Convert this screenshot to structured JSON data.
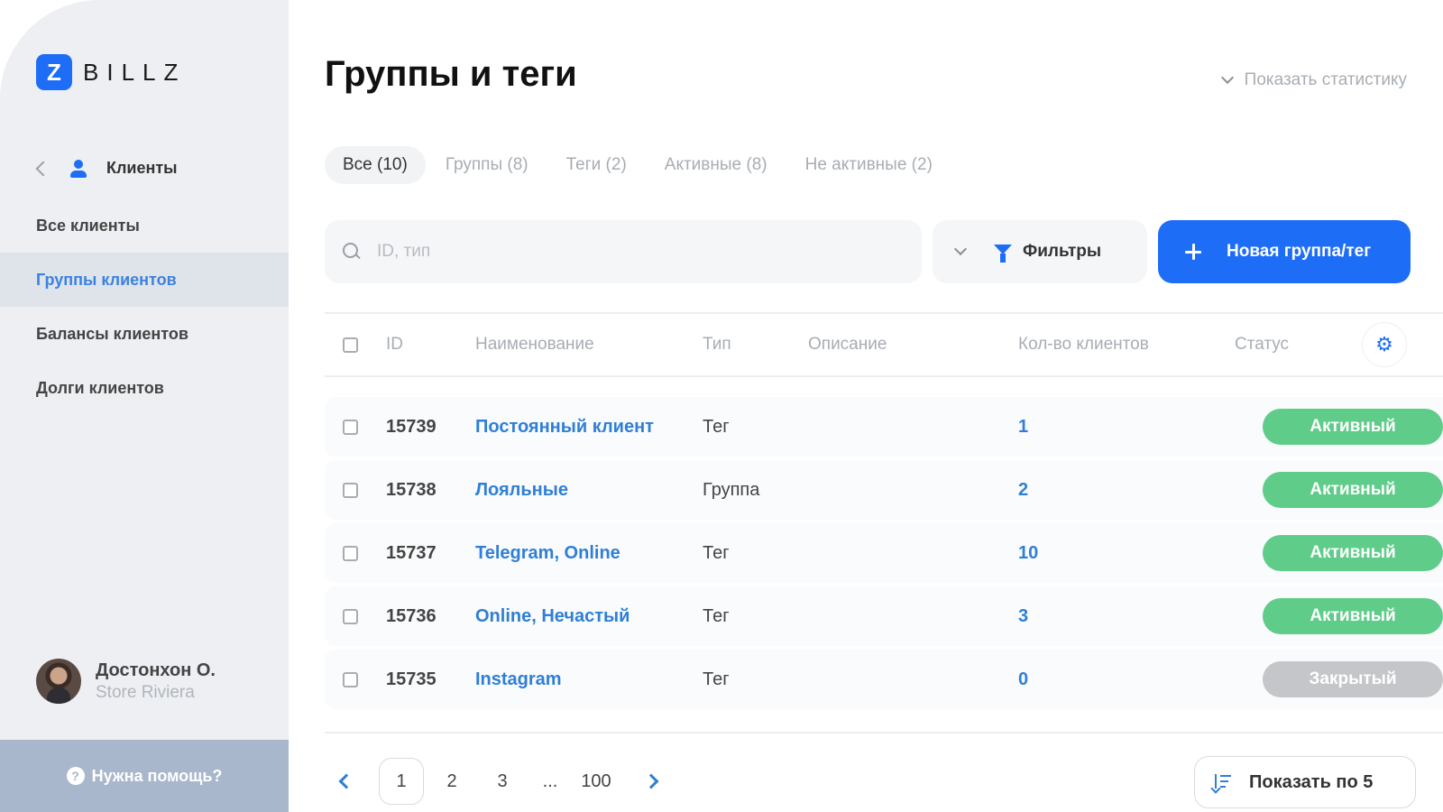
{
  "brand": {
    "mark": "Z",
    "name": "BILLZ",
    "color": "#1e6df6"
  },
  "sidebar": {
    "section": "Клиенты",
    "items": [
      {
        "label": "Все клиенты",
        "active": false
      },
      {
        "label": "Группы клиентов",
        "active": true
      },
      {
        "label": "Балансы клиентов",
        "active": false
      },
      {
        "label": "Долги клиентов",
        "active": false
      }
    ],
    "profile": {
      "name": "Достонхон О.",
      "store": "Store Riviera"
    },
    "help": "Нужна помощь?"
  },
  "header": {
    "title": "Группы и теги",
    "stats_toggle": "Показать статистику"
  },
  "tabs": [
    {
      "label": "Все (10)",
      "active": true
    },
    {
      "label": "Группы (8)",
      "active": false
    },
    {
      "label": "Теги (2)",
      "active": false
    },
    {
      "label": "Активные (8)",
      "active": false
    },
    {
      "label": "Не активные (2)",
      "active": false
    }
  ],
  "toolbar": {
    "search_placeholder": "ID, тип",
    "filters_label": "Фильтры",
    "new_button": "Новая группа/тег"
  },
  "table": {
    "columns": [
      "ID",
      "Наименование",
      "Тип",
      "Описание",
      "Кол-во клиентов",
      "Статус"
    ],
    "rows": [
      {
        "id": "15739",
        "name": "Постоянный клиент",
        "type": "Тег",
        "description": "",
        "count": "1",
        "status": "Активный",
        "status_color": "#5fcc8a"
      },
      {
        "id": "15738",
        "name": "Лояльные",
        "type": "Группа",
        "description": "",
        "count": "2",
        "status": "Активный",
        "status_color": "#5fcc8a"
      },
      {
        "id": "15737",
        "name": "Telegram, Online",
        "type": "Тег",
        "description": "",
        "count": "10",
        "status": "Активный",
        "status_color": "#5fcc8a"
      },
      {
        "id": "15736",
        "name": "Online, Нечастый",
        "type": "Тег",
        "description": "",
        "count": "3",
        "status": "Активный",
        "status_color": "#5fcc8a"
      },
      {
        "id": "15735",
        "name": "Instagram",
        "type": "Тег",
        "description": "",
        "count": "0",
        "status": "Закрытый",
        "status_color": "#c4c6c9"
      }
    ]
  },
  "pagination": {
    "pages": [
      "1",
      "2",
      "3",
      "...",
      "100"
    ],
    "current": "1",
    "per_page_label": "Показать по 5"
  }
}
